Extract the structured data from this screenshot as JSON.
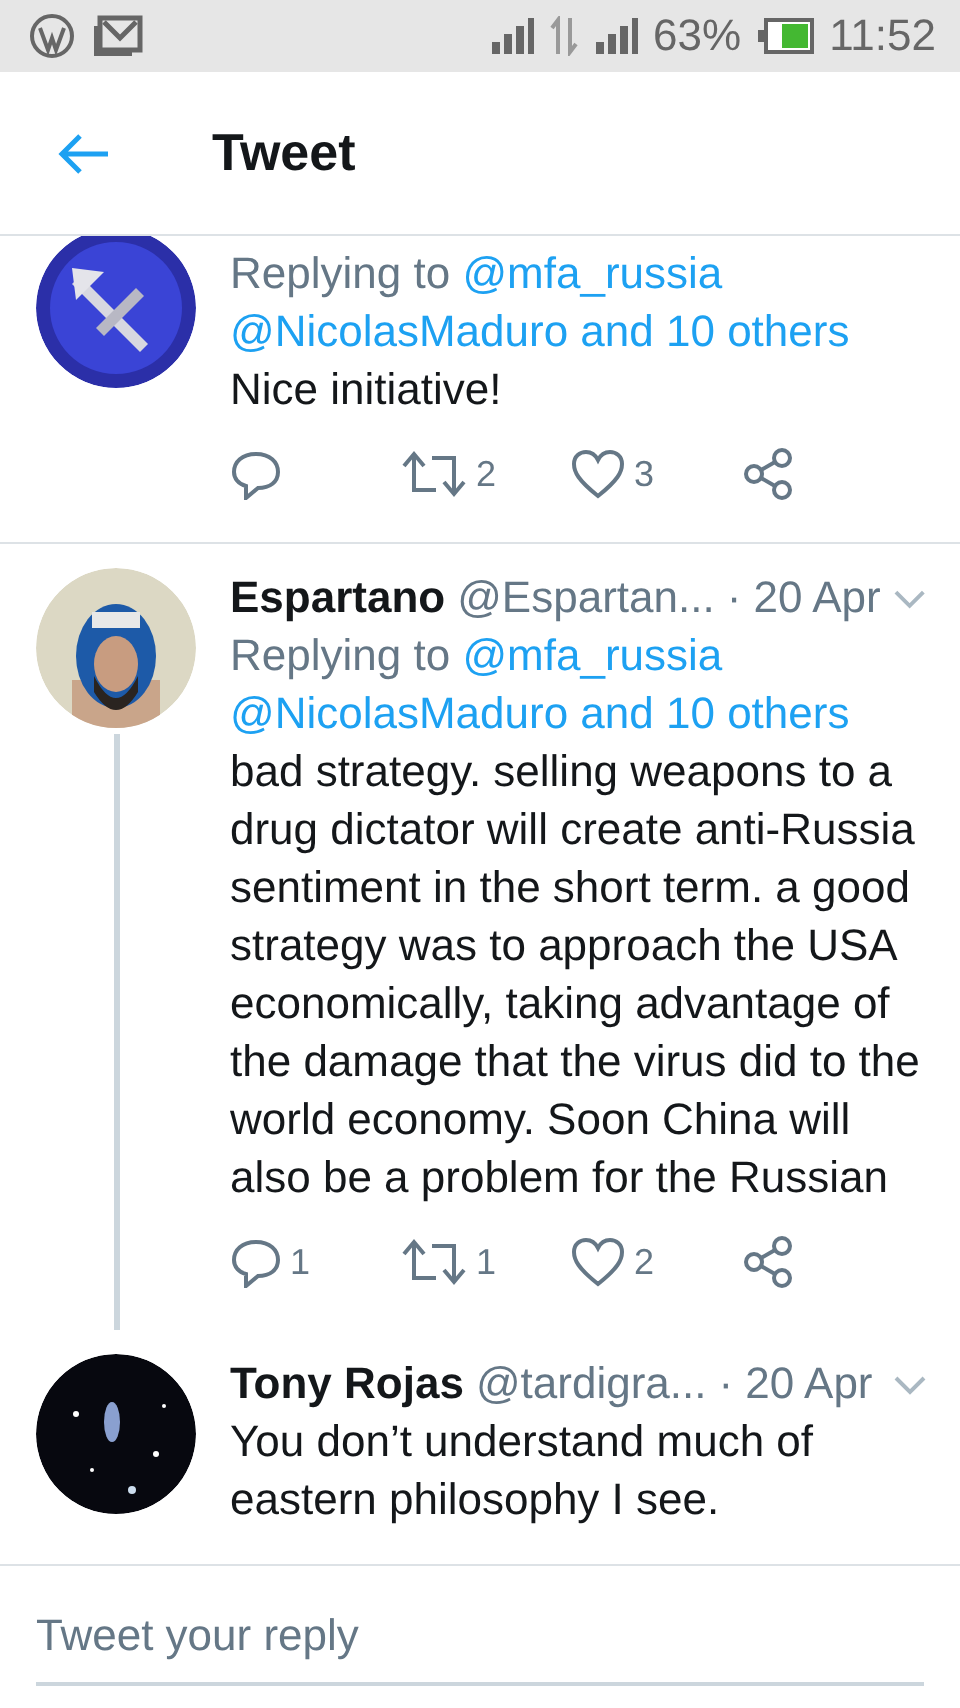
{
  "status_bar": {
    "battery": "63%",
    "time": "11:52"
  },
  "header": {
    "title": "Tweet"
  },
  "tweets": [
    {
      "kind": "clipped",
      "replying": {
        "label": "Replying to",
        "mentions": [
          "@mfa_russia",
          "@NicolasMaduro and 10 others"
        ]
      },
      "text": "Nice initiative!",
      "actions": [
        {
          "kind": "reply"
        },
        {
          "kind": "retweet",
          "count": "2"
        },
        {
          "kind": "like",
          "count": "3"
        },
        {
          "kind": "share"
        }
      ],
      "thread_line": false
    },
    {
      "kind": "full",
      "name": "Espartano",
      "handle": "@Espartan...",
      "date": "· 20 Apr",
      "replying": {
        "label": "Replying to",
        "mentions": [
          "@mfa_russia",
          "@NicolasMaduro and 10 others"
        ]
      },
      "text": "bad strategy.  selling weapons to a drug dictator will create anti-Russia sentiment in the short term.  a good strategy was to approach the USA economically, taking advantage of the damage that the virus did to the world economy.  Soon China will also be a problem for the Russian",
      "actions": [
        {
          "kind": "reply",
          "count": "1"
        },
        {
          "kind": "retweet",
          "count": "1"
        },
        {
          "kind": "like",
          "count": "2"
        },
        {
          "kind": "share"
        }
      ],
      "thread_line": true
    },
    {
      "kind": "full",
      "name": "Tony Rojas",
      "handle": "@tardigra...",
      "date": "· 20 Apr",
      "text": "You don’t understand much of eastern philosophy I see.",
      "thread_line": false
    }
  ],
  "reply_box": {
    "placeholder": "Tweet your reply"
  }
}
